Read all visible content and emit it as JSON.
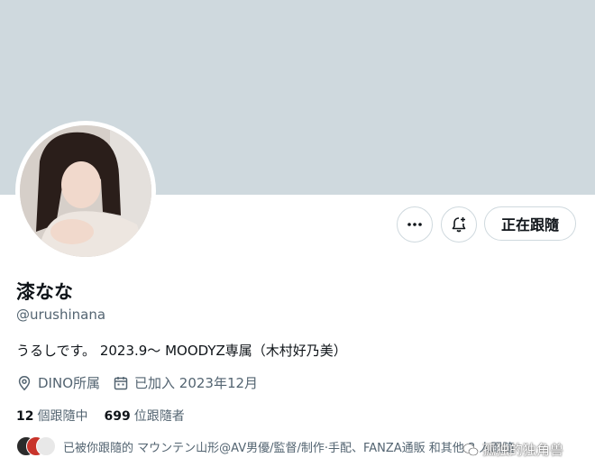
{
  "profile": {
    "display_name": "漆なな",
    "handle": "@urushinana",
    "bio": "うるしです。 2023.9～ MOODYZ専属（木村好乃美）",
    "location": "DINO所属",
    "joined": "已加入 2023年12月"
  },
  "actions": {
    "more_icon": "more-horizontal-icon",
    "notify_icon": "bell-plus-icon",
    "following_label": "正在跟隨"
  },
  "stats": {
    "following_count": "12",
    "following_label": "個跟隨中",
    "followers_count": "699",
    "followers_label": "位跟隨者"
  },
  "known_followers": {
    "text": "已被你跟隨的 マウンテン山形@AV男優/監督/制作·手配、FANZA通販 和其他 3 人跟隨"
  },
  "watermark": {
    "text": "孤独的独角兽"
  },
  "colors": {
    "banner": "#cfd9de",
    "secondary_text": "#536471",
    "primary_text": "#0f1419"
  }
}
